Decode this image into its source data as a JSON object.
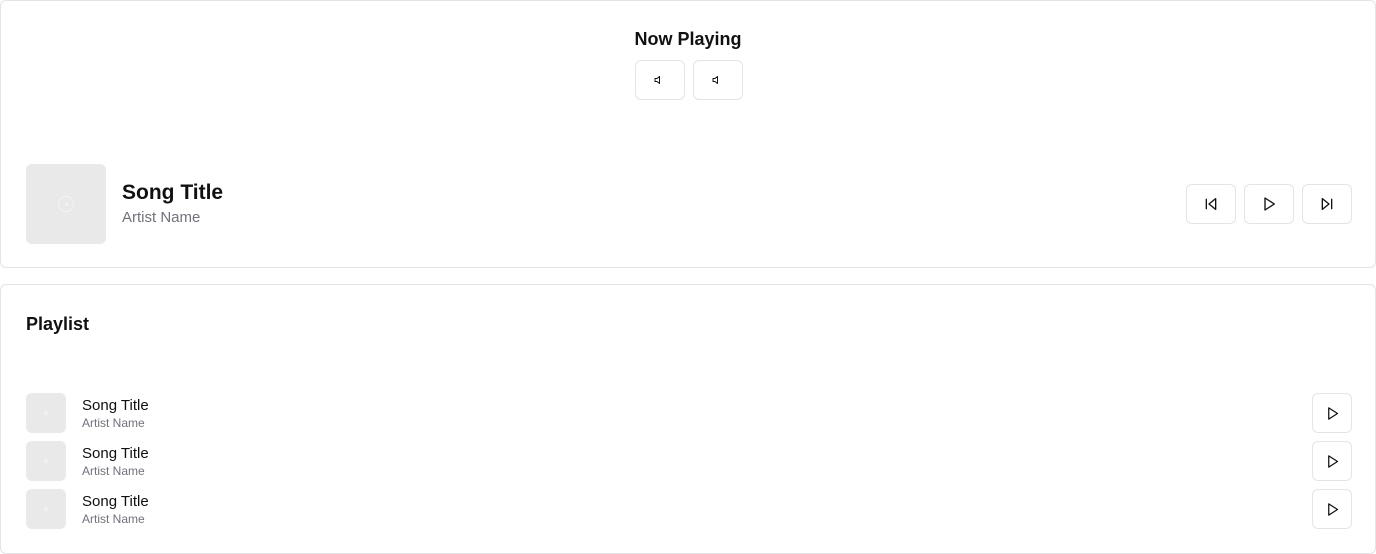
{
  "now_playing": {
    "heading": "Now Playing",
    "volume_buttons": [
      {
        "icon": "speaker-icon"
      },
      {
        "icon": "speaker-icon"
      }
    ],
    "track": {
      "title": "Song Title",
      "artist": "Artist Name",
      "cover_icon": "disc-icon"
    },
    "controls": [
      {
        "icon": "skip-back-icon"
      },
      {
        "icon": "play-icon"
      },
      {
        "icon": "skip-forward-icon"
      }
    ]
  },
  "playlist": {
    "heading": "Playlist",
    "items": [
      {
        "title": "Song Title",
        "artist": "Artist Name"
      },
      {
        "title": "Song Title",
        "artist": "Artist Name"
      },
      {
        "title": "Song Title",
        "artist": "Artist Name"
      }
    ]
  },
  "colors": {
    "border": "#e4e4e7",
    "muted_text": "#71717a",
    "cover_placeholder": "#e9e9e9"
  }
}
